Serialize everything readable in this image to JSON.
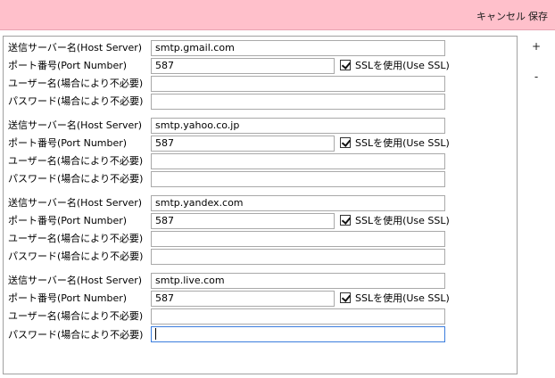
{
  "toolbar": {
    "cancel_label": "キャンセル",
    "save_label": "保存"
  },
  "side": {
    "add_label": "+",
    "remove_label": "-"
  },
  "labels": {
    "host": "送信サーバー名(Host Server)",
    "port": "ポート番号(Port Number)",
    "user": "ユーザー名(場合により不必要)",
    "password": "パスワード(場合により不必要)",
    "ssl": "SSLを使用(Use SSL)"
  },
  "servers": [
    {
      "host": "smtp.gmail.com",
      "port": "587",
      "user": "",
      "password": "",
      "use_ssl": true
    },
    {
      "host": "smtp.yahoo.co.jp",
      "port": "587",
      "user": "",
      "password": "",
      "use_ssl": true
    },
    {
      "host": "smtp.yandex.com",
      "port": "587",
      "user": "",
      "password": "",
      "use_ssl": true
    },
    {
      "host": "smtp.live.com",
      "port": "587",
      "user": "",
      "password": "",
      "use_ssl": true
    }
  ]
}
